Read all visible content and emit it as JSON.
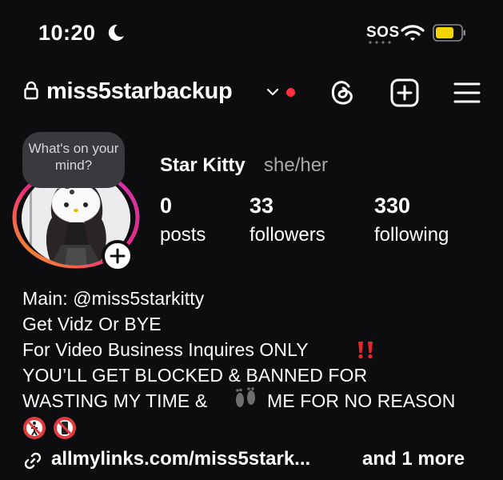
{
  "status_bar": {
    "time": "10:20",
    "carrier": "SOS",
    "icons": [
      "moon-icon",
      "wifi-icon",
      "battery-icon"
    ],
    "battery_color": "#f5d500"
  },
  "header": {
    "username": "miss5starbackup",
    "has_notification_dot": true,
    "accent": "#ff3040",
    "icons": [
      "lock-icon",
      "chevron-down-icon",
      "threads-icon",
      "create-plus-icon",
      "menu-icon"
    ]
  },
  "profile": {
    "note_bubble": "What's on your mind?",
    "display_name": "Star Kitty",
    "pronouns": "she/her",
    "stats": [
      {
        "value": "0",
        "label": "posts"
      },
      {
        "value": "33",
        "label": "followers"
      },
      {
        "value": "330",
        "label": "following"
      }
    ]
  },
  "bio": {
    "lines": [
      "Main: @miss5starkitty",
      "Get Vidz Or BYE",
      "For Video Business Inquires ONLY",
      "YOU’LL GET BLOCKED & BANNED FOR",
      "WASTING MY TIME &",
      "ME FOR NO REASON"
    ],
    "link": "allmylinks.com/miss5stark...",
    "link_more": "and 1 more"
  }
}
